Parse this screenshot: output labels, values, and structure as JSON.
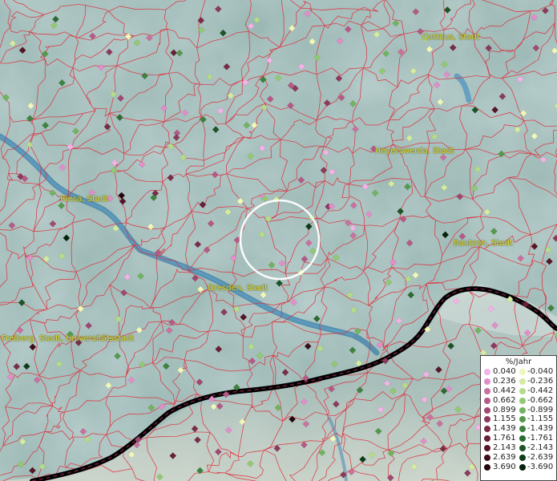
{
  "map": {
    "city_labels": [
      {
        "id": "cottbus",
        "text": "Cottbus, Stadt",
        "xf": 0.758,
        "yf": 0.068
      },
      {
        "id": "hoyerswerda",
        "text": "Hoyerswerda, Stadt",
        "xf": 0.673,
        "yf": 0.305
      },
      {
        "id": "riesa",
        "text": "Riesa, Stadt",
        "xf": 0.108,
        "yf": 0.405
      },
      {
        "id": "bautzen",
        "text": "Bautzen, Stadt",
        "xf": 0.814,
        "yf": 0.497
      },
      {
        "id": "dresden",
        "text": "Dresden, Stadt",
        "xf": 0.373,
        "yf": 0.59
      },
      {
        "id": "freiberg",
        "text": "Freiberg, Stadt, Universitätsstadt",
        "xf": 0.003,
        "yf": 0.695
      }
    ]
  },
  "legend": {
    "title": "%/Jahr",
    "positive": [
      {
        "value": "0.040",
        "color": "#f2b3e6"
      },
      {
        "value": "0.236",
        "color": "#e08fc9"
      },
      {
        "value": "0.442",
        "color": "#c9719f"
      },
      {
        "value": "0.662",
        "color": "#b45a85"
      },
      {
        "value": "0.899",
        "color": "#a04970"
      },
      {
        "value": "1.155",
        "color": "#8c3a5b"
      },
      {
        "value": "1.439",
        "color": "#7a2c47"
      },
      {
        "value": "1.761",
        "color": "#692035"
      },
      {
        "value": "2.143",
        "color": "#561626"
      },
      {
        "value": "2.639",
        "color": "#3e0d18"
      },
      {
        "value": "3.690",
        "color": "#24050b"
      }
    ],
    "negative": [
      {
        "value": "-0.040",
        "color": "#f0f7b9"
      },
      {
        "value": "-0.236",
        "color": "#d4ec9f"
      },
      {
        "value": "-0.442",
        "color": "#b5dc8a"
      },
      {
        "value": "-0.662",
        "color": "#93c973"
      },
      {
        "value": "-0.899",
        "color": "#72b35f"
      },
      {
        "value": "-1.155",
        "color": "#549a4c"
      },
      {
        "value": "-1.439",
        "color": "#3e8240"
      },
      {
        "value": "-1.761",
        "color": "#2c6b33"
      },
      {
        "value": "-2.143",
        "color": "#1c5426"
      },
      {
        "value": "-2.639",
        "color": "#0f3d18"
      },
      {
        "value": "-3.690",
        "color": "#05220b"
      }
    ]
  }
}
